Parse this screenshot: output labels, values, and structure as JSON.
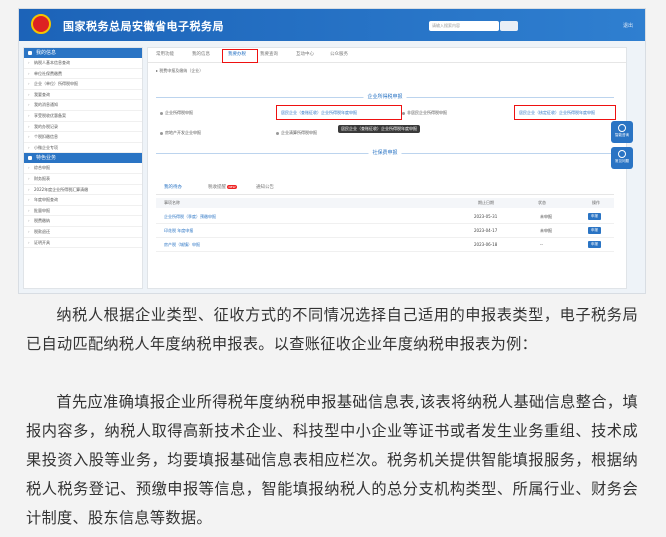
{
  "screenshot": {
    "header": {
      "site_title": "国家税务总局安徽省电子税务局",
      "search_placeholder": "请输入搜索内容",
      "links": [
        "退出"
      ],
      "badge": ""
    },
    "sidebar": {
      "section1": "我的信息",
      "items1": [
        "纳税人基本信息查询",
        "单位社保费缴费",
        "企业（单位）所得税申报",
        "我要查询",
        "我的消息通知",
        "享受税收优惠备案",
        "我的办税记录",
        "个税扣缴信息",
        "小微企业专项"
      ],
      "section2": "特色业务",
      "items2": [
        "综合申报",
        "财务报表",
        "2022年度企业所得税汇算清缴",
        "年度申报查询",
        "批量申报",
        "税费缴纳",
        "税款退还",
        "证明开具"
      ]
    },
    "main": {
      "tabs": [
        "常用功能",
        "我的信息",
        "我要办税",
        "我要查询",
        "互动中心",
        "公众服务"
      ],
      "active_tab": 2,
      "crumb": "▸ 税费申报及缴纳（企业）",
      "section_enterprise": "企业所得税申报",
      "section_social": "社保费申报",
      "row1_left": "企业所得税申报",
      "link_a": "居民企业（查账征收）企业所得税年度申报",
      "link_b": "居民企业（核定征收）企业所得税年度申报",
      "row1_mid": "非居民企业所得税申报",
      "row2_left": "房地产开发企业申报",
      "row2_mid": "企业清算所得税申报",
      "popup": "居民企业（查账征收）企业所得税年度申报",
      "subtabs": [
        "我的待办",
        "税收提醒",
        "通知公告"
      ],
      "subtab_new": "NEW",
      "table_headers": [
        "事项名称",
        "期止日期",
        "状态",
        "操作"
      ],
      "rows": [
        {
          "name": "企业所得税（季度）预缴申报",
          "date": "2023-05-31",
          "status": "未申报",
          "op": "申报"
        },
        {
          "name": "印花税 年度申报",
          "date": "2023-04-17",
          "status": "未申报",
          "op": "申报"
        },
        {
          "name": "房产税（城镇）申报",
          "date": "2023-06-18",
          "status": "--",
          "op": "申报"
        }
      ],
      "float_btns": [
        "智能咨询",
        "常见问题"
      ]
    }
  },
  "paragraphs": [
    "纳税人根据企业类型、征收方式的不同情况选择自己适用的申报表类型，电子税务局已自动匹配纳税人年度纳税申报表。以查账征收企业年度纳税申报表为例：",
    "首先应准确填报企业所得税年度纳税申报基础信息表,该表将纳税人基础信息整合，填报内容多，纳税人取得高新技术企业、科技型中小企业等证书或者发生业务重组、技术成果投资入股等业务，均要填报基础信息表相应栏次。税务机关提供智能填报服务，根据纳税人税务登记、预缴申报等信息，智能填报纳税人的总分支机构类型、所属行业、财务会计制度、股东信息等数据。"
  ]
}
